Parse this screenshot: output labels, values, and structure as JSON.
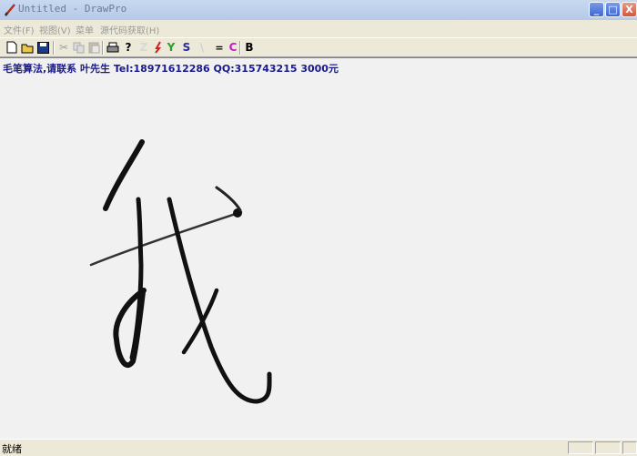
{
  "window": {
    "title": "Untitled - DrawPro",
    "buttons": {
      "minimize": "_",
      "maximize": "□",
      "close": "X"
    }
  },
  "menu": [
    "文件(F)",
    "视图(V)",
    "菜单",
    "源代码获取(H)"
  ],
  "toolbar": {
    "icons": [
      "new-icon",
      "open-icon",
      "save-icon",
      "cut-icon",
      "copy-icon",
      "paste-icon",
      "print-icon",
      "help-icon",
      "pen-icon",
      "red-brush-icon"
    ],
    "labels": {
      "y": "Y",
      "s": "S",
      "eq": "=",
      "c": "C",
      "b": "B",
      "z": "Z",
      "slash": "\\"
    }
  },
  "canvas": {
    "info_text": "毛笔算法,请联系 叶先生 Tel:18971612286 QQ:315743215 3000元",
    "glyph": "我"
  },
  "status": {
    "text": "就绪"
  },
  "colors": {
    "title_gradient_top": "#c8d8ef",
    "title_gradient_bottom": "#b6c9e8",
    "info_text": "#1a1a8c",
    "canvas_bg": "#f1f1f1",
    "ink": "#101010"
  }
}
